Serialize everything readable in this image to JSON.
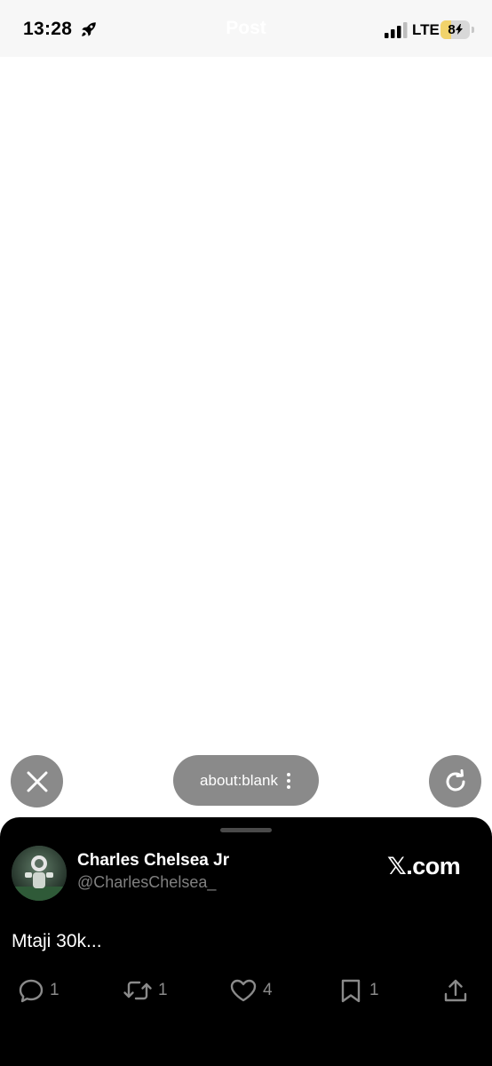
{
  "status_bar": {
    "time": "13:28",
    "title": "Post",
    "network": "LTE",
    "battery_level": "8",
    "battery_fill_fraction": 0.08
  },
  "browser_controls": {
    "url": "about:blank",
    "close_icon": "close-icon",
    "more_icon": "vertical-dots-icon",
    "reload_icon": "reload-icon"
  },
  "post": {
    "author_name": "Charles Chelsea Jr",
    "author_handle": "@CharlesChelsea_",
    "site": "𝕏.com",
    "text": "Mtaji 30k...",
    "actions": [
      {
        "icon": "reply-icon",
        "count": "1"
      },
      {
        "icon": "repost-icon",
        "count": "1"
      },
      {
        "icon": "like-icon",
        "count": "4"
      },
      {
        "icon": "bookmark-icon",
        "count": "1"
      },
      {
        "icon": "share-icon",
        "count": ""
      }
    ]
  },
  "colors": {
    "sheet_background": "#000000",
    "button_gray": "#8a8a8a",
    "battery_yellow": "#f1d36b",
    "muted_text": "#808080"
  }
}
